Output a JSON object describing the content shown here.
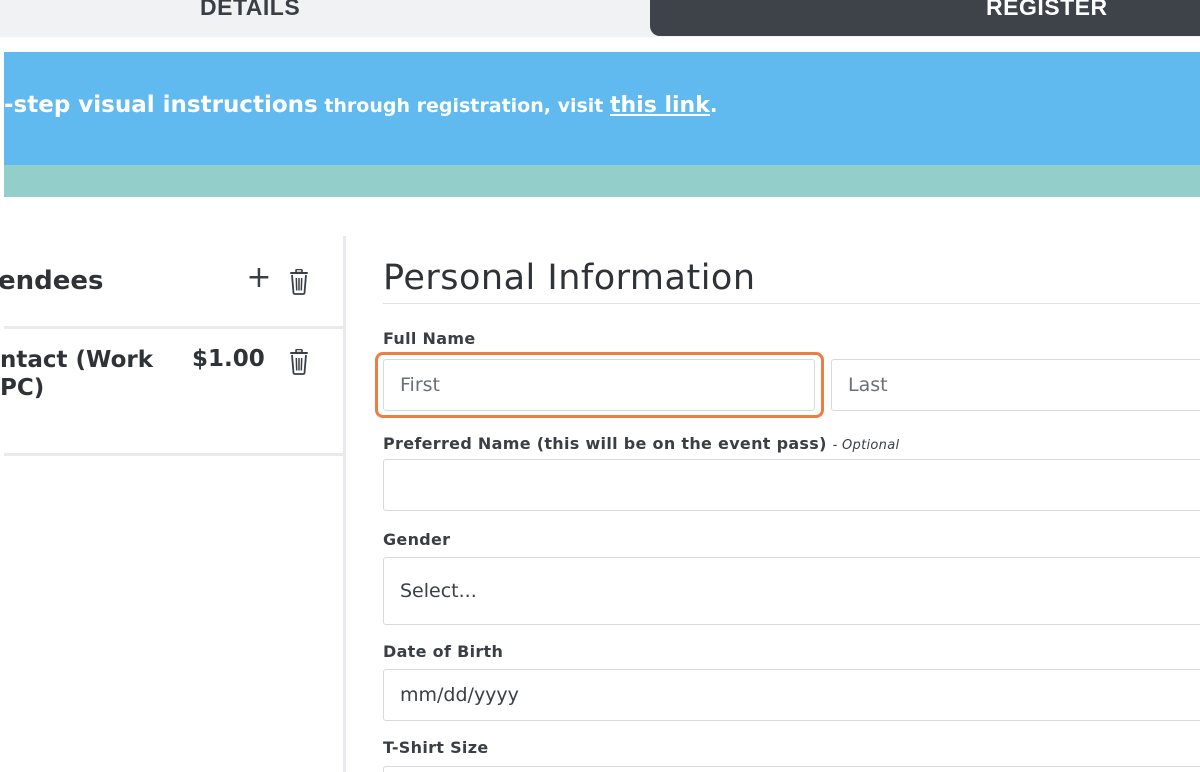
{
  "tabs": {
    "details_label": "DETAILS",
    "register_label": "REGISTER"
  },
  "banner": {
    "strong_text": "-step visual instructions",
    "normal_text": " through registration, visit ",
    "link_text": "this link",
    "tail": "."
  },
  "attendees": {
    "title": "endees",
    "items": [
      {
        "name": "ntact (Work PC)",
        "price": "$1.00"
      }
    ]
  },
  "form": {
    "section_title": "Personal Information",
    "full_name_label": "Full Name",
    "first_placeholder": "First",
    "last_placeholder": "Last",
    "preferred_label": "Preferred Name (this will be on the event pass)",
    "optional_text": "- Optional",
    "gender_label": "Gender",
    "gender_value": "Select...",
    "dob_label": "Date of Birth",
    "dob_placeholder": "mm/dd/yyyy",
    "tshirt_label": "T-Shirt Size"
  },
  "colors": {
    "banner": "#60b9ef",
    "teal_strip": "#94ceca",
    "register_tab": "#3e4349",
    "focus_ring": "#ef7b45"
  },
  "icons": {
    "add": "plus-icon",
    "delete": "trash-icon"
  }
}
